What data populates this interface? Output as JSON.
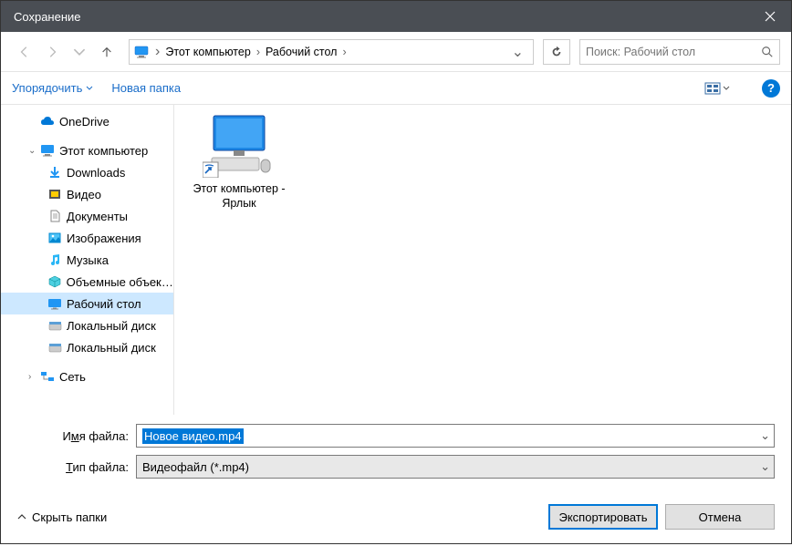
{
  "title": "Сохранение",
  "breadcrumb": {
    "item1": "Этот компьютер",
    "item2": "Рабочий стол"
  },
  "search_placeholder": "Поиск: Рабочий стол",
  "toolbar": {
    "organize": "Упорядочить",
    "new_folder": "Новая папка"
  },
  "sidebar": {
    "onedrive": "OneDrive",
    "this_pc": "Этот компьютер",
    "downloads": "Downloads",
    "video": "Видео",
    "documents": "Документы",
    "images": "Изображения",
    "music": "Музыка",
    "volumes": "Объемные объекты",
    "desktop": "Рабочий стол",
    "local_disk1": "Локальный диск",
    "local_disk2": "Локальный диск",
    "network": "Сеть"
  },
  "content": {
    "shortcut_label": "Этот компьютер - Ярлык"
  },
  "fields": {
    "filename_label_pre": "И",
    "filename_label_u": "м",
    "filename_label_post": "я файла:",
    "filename_value": "Новое видео.mp4",
    "filetype_label_pre": "",
    "filetype_label_u": "Т",
    "filetype_label_post": "ип файла:",
    "filetype_value": "Видеофайл (*.mp4)"
  },
  "footer": {
    "hide_folders": "Скрыть папки",
    "export": "Экспортировать",
    "cancel": "Отмена"
  }
}
